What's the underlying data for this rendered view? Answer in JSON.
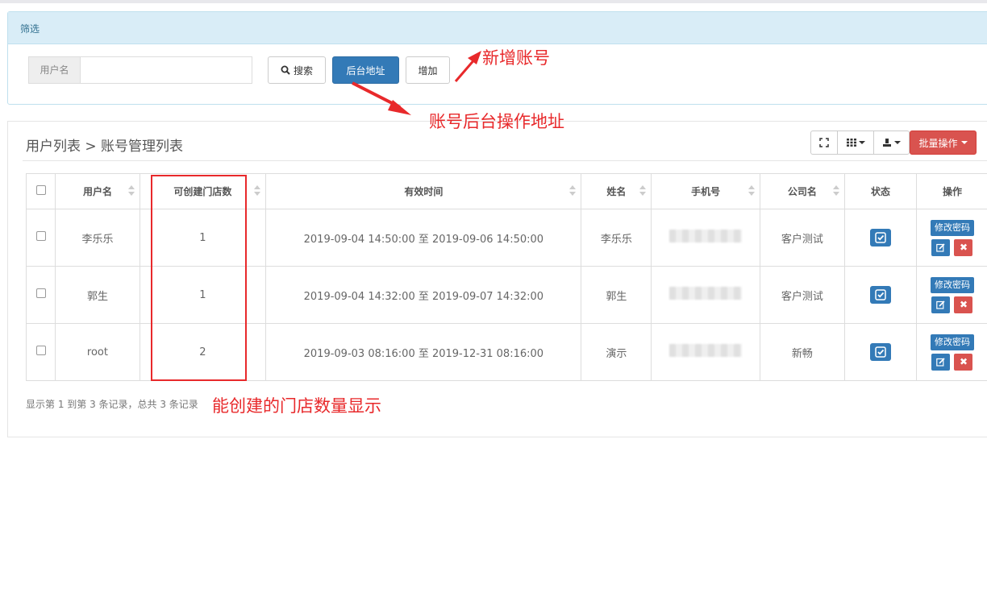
{
  "filter": {
    "title": "筛选",
    "username_label": "用户名",
    "username_value": "",
    "search_button": "搜索",
    "backend_button": "后台地址",
    "add_button": "增加"
  },
  "list": {
    "breadcrumb": "用户列表 > 账号管理列表",
    "batch_button": "批量操作",
    "columns": [
      "用户名",
      "可创建门店数",
      "有效时间",
      "姓名",
      "手机号",
      "公司名",
      "状态",
      "操作"
    ],
    "rows": [
      {
        "username": "李乐乐",
        "store_count": "1",
        "valid_time": "2019-09-04 14:50:00 至 2019-09-06 14:50:00",
        "name": "李乐乐",
        "phone": "",
        "company": "客户测试"
      },
      {
        "username": "郭生",
        "store_count": "1",
        "valid_time": "2019-09-04 14:32:00 至 2019-09-07 14:32:00",
        "name": "郭生",
        "phone": "",
        "company": "客户测试"
      },
      {
        "username": "root",
        "store_count": "2",
        "valid_time": "2019-09-03 08:16:00 至 2019-12-31 08:16:00",
        "name": "演示",
        "phone": "",
        "company": "新畅"
      }
    ],
    "op_change_password": "修改密码",
    "summary": "显示第 1 到第 3 条记录，总共 3 条记录"
  },
  "annotations": {
    "add_account": "新增账号",
    "backend_address": "账号后台操作地址",
    "store_count_display": "能创建的门店数量显示"
  },
  "colors": {
    "primary": "#337ab7",
    "danger": "#d9534f",
    "annotation": "#e8292b",
    "panel_header": "#d9edf7"
  }
}
